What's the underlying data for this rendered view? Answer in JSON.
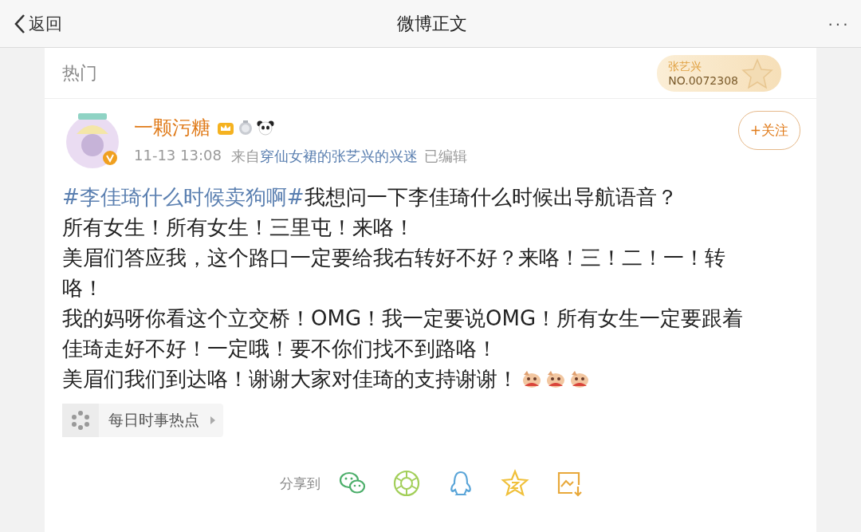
{
  "nav": {
    "back": "返回",
    "title": "微博正文",
    "more": "···"
  },
  "section": {
    "title": "热门",
    "fan_badge": {
      "name": "张艺兴",
      "number": "NO.0072308"
    }
  },
  "post": {
    "author": "一颗污糖",
    "time": "11-13 13:08",
    "source_prefix": "来自",
    "source": "穿仙女裙的张艺兴的兴迷",
    "edited": "已编辑",
    "follow": "+关注",
    "lines": [
      {
        "hashtag": "#李佳琦什么时候卖狗啊#",
        "text": "我想问一下李佳琦什么时候出导航语音？"
      },
      {
        "text": "所有女生！所有女生！三里屯！来咯！"
      },
      {
        "text": "美眉们答应我，这个路口一定要给我右转好不好？来咯！三！二！一！转"
      },
      {
        "text": "咯！"
      },
      {
        "text": "我的妈呀你看这个立交桥！OMG！我一定要说OMG！所有女生一定要跟着"
      },
      {
        "text": "佳琦走好不好！一定哦！要不你们找不到路咯！"
      },
      {
        "text": "美眉们我们到达咯！谢谢大家对佳琦的支持谢谢！",
        "stickers": [
          {
            "kind": "sticker"
          },
          {
            "kind": "sticker"
          },
          {
            "kind": "sticker"
          }
        ]
      }
    ],
    "topic": "每日时事热点",
    "share_label": "分享到",
    "share": [
      {
        "kind": "wechat"
      },
      {
        "kind": "moments"
      },
      {
        "kind": "qq"
      },
      {
        "kind": "qzone"
      },
      {
        "kind": "save"
      }
    ]
  }
}
